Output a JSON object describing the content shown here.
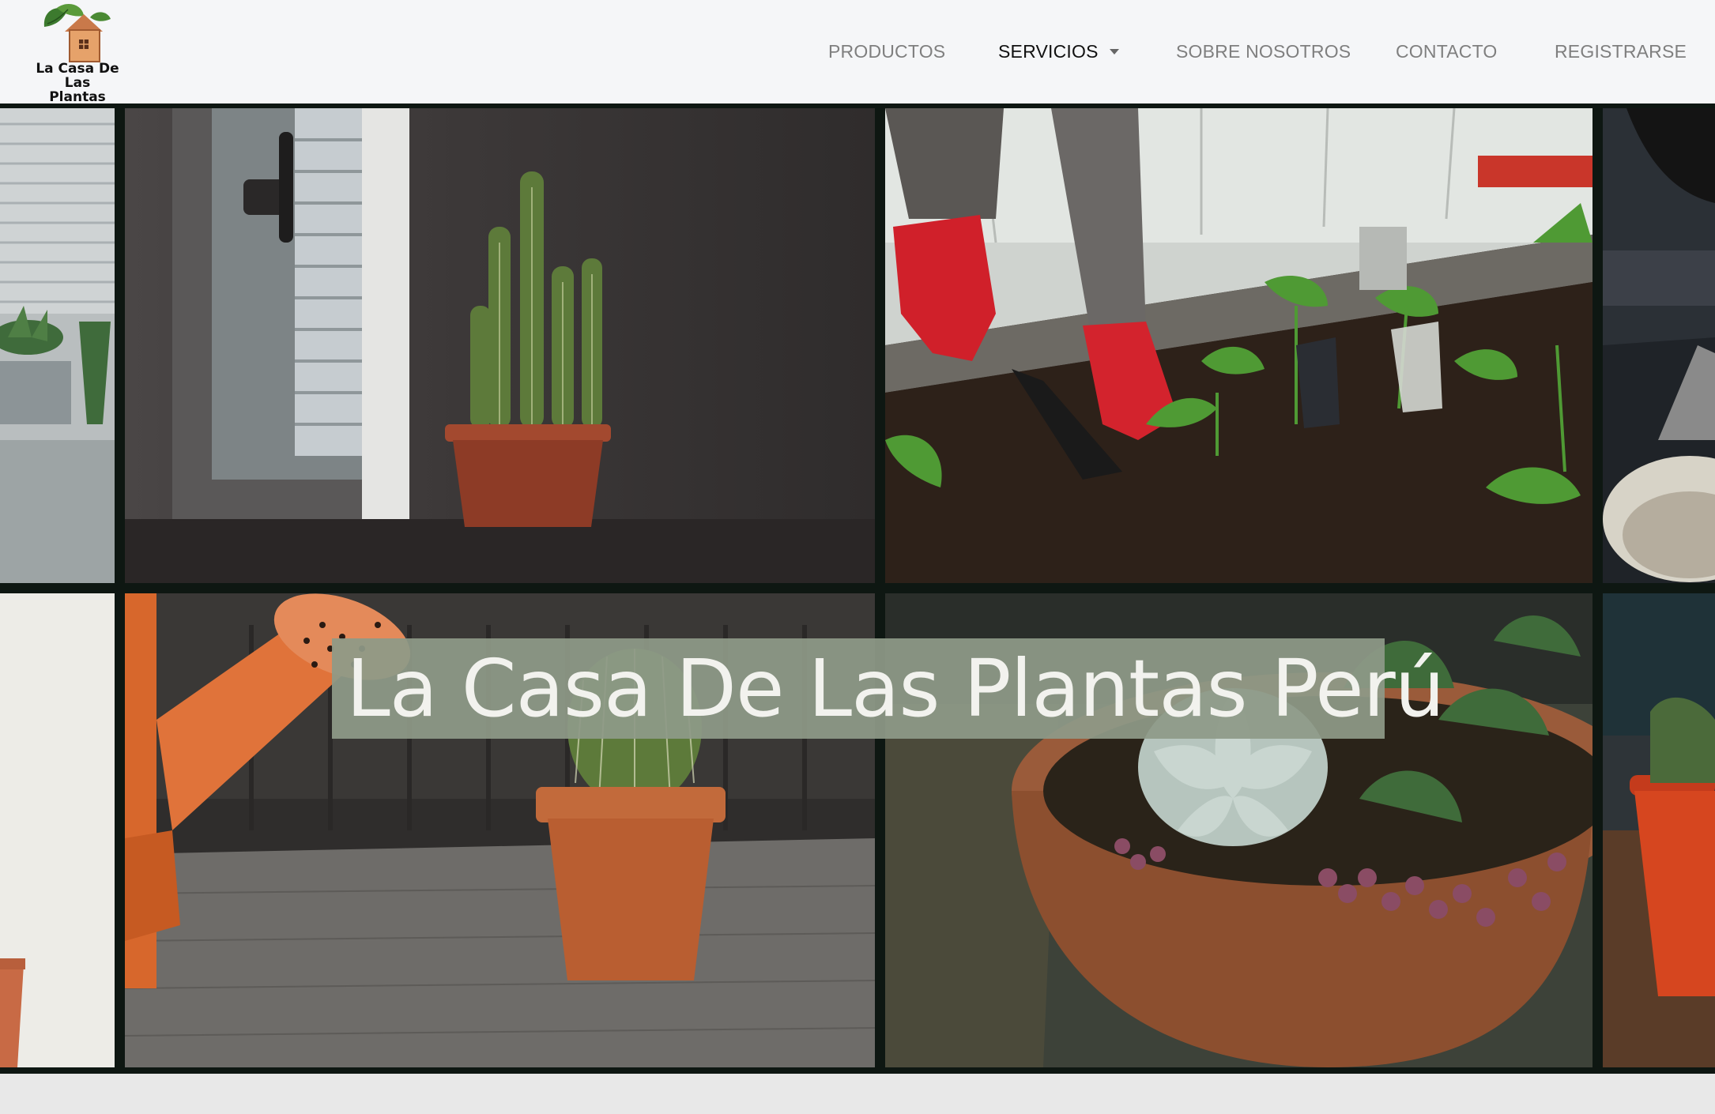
{
  "header": {
    "logo_line1": "La Casa De",
    "logo_line2": "Las Plantas",
    "logo_icon": "house-plant-logo"
  },
  "nav": {
    "items": [
      {
        "label": "PRODUCTOS"
      },
      {
        "label": "SERVICIOS",
        "has_dropdown": true,
        "active": true
      },
      {
        "label": "SOBRE NOSOTROS"
      },
      {
        "label": "CONTACTO"
      },
      {
        "label": "REGISTRARSE"
      }
    ]
  },
  "hero": {
    "title": "La Casa De Las Plantas Perú",
    "images": [
      "window-blinds-succulents-photo",
      "cactus-by-window-photo",
      "gardener-planting-seedlings-photo",
      "partial-tile-right-top-photo",
      "white-wall-pot-photo",
      "watering-can-cactus-photo",
      "succulent-bowl-photo",
      "red-pot-partial-photo"
    ]
  },
  "colors": {
    "header_bg": "#f5f6f8",
    "nav_text": "#7f7f7f",
    "nav_active": "#111111",
    "title_overlay": "#8e9a88",
    "grid_gap": "#0e1712"
  }
}
